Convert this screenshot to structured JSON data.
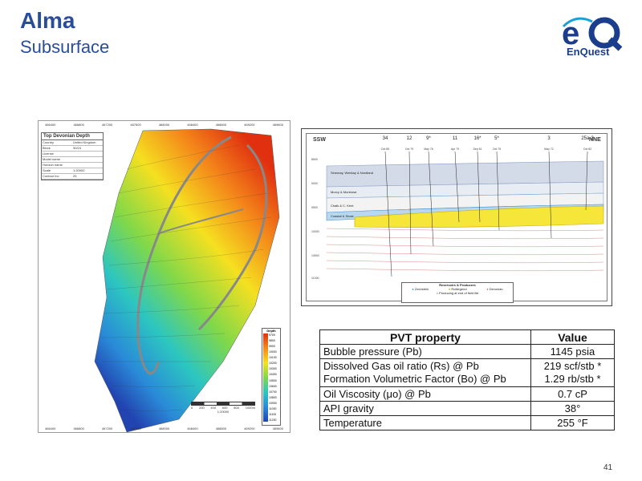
{
  "slide": {
    "title": "Alma",
    "subtitle": "Subsurface",
    "page_number": "41"
  },
  "logo": {
    "text": "EnQuest",
    "mark": "eQ",
    "colors": {
      "primary": "#1a3e8c",
      "accent": "#1aa0d8"
    }
  },
  "depth_map": {
    "title": "Top Devonian Depth",
    "legend_rows": [
      {
        "label": "Country",
        "value": "United Kingdom"
      },
      {
        "label": "Block",
        "value": "30/24"
      },
      {
        "label": "License",
        "value": ""
      },
      {
        "label": "Model name",
        "value": ""
      },
      {
        "label": "Horizon name",
        "value": ""
      },
      {
        "label": "Scale",
        "value": "1:20000"
      },
      {
        "label": "Contour inc",
        "value": "25"
      }
    ],
    "top_ticks": [
      "466400",
      "466800",
      "467200",
      "467600",
      "468000",
      "468400",
      "468800",
      "469200",
      "469600"
    ],
    "bottom_ticks": [
      "466400",
      "466800",
      "467200",
      "467600",
      "468000",
      "468400",
      "468800",
      "469200",
      "469600"
    ],
    "depth_scale_title": "Depth",
    "depth_scale_values": [
      "9700",
      "9800",
      "9900",
      "10000",
      "10100",
      "10200",
      "10300",
      "10400",
      "10500",
      "10600",
      "10700",
      "10800",
      "10900",
      "11000",
      "11100",
      "11200"
    ],
    "scale_values": [
      "0",
      "200",
      "400",
      "600",
      "800",
      "1000m"
    ],
    "scale_text": "1:20000"
  },
  "cross_section": {
    "left_label": "SSW",
    "right_label": "NNE",
    "wells": [
      {
        "name": "34",
        "date": "Oct 85"
      },
      {
        "name": "12",
        "date": "Oct 79"
      },
      {
        "name": "9*",
        "date": "May 76"
      },
      {
        "name": "11",
        "date": "Apr 79"
      },
      {
        "name": "16*",
        "date": "Sep 81"
      },
      {
        "name": "5*",
        "date": "Oct 75"
      },
      {
        "name": "3",
        "date": "May 72"
      },
      {
        "name": "25a-2",
        "date": "Oct 82"
      }
    ],
    "depths": [
      "8500",
      "9000",
      "9500",
      "10000",
      "10500",
      "11000"
    ],
    "formations": [
      "Sinemay, Weekay & Nordland",
      "Murcy & Montrose",
      "Chalk & C. Kent",
      "Coastal & Shale"
    ],
    "legend_title": "Reservoirs & Producers",
    "legend_items": [
      "Zechstein",
      "Rotliegend",
      "Devonian"
    ],
    "legend_note": "= Producing at end of field life"
  },
  "pvt_table": {
    "headers": {
      "property": "PVT property",
      "value": "Value"
    },
    "rows": [
      {
        "property": "Bubble pressure (Pb)",
        "value": "1145 psia"
      },
      {
        "property": "Dissolved Gas oil ratio (Rs) @ Pb",
        "value": "219 scf/stb *"
      },
      {
        "property": "Formation Volumetric Factor (Bo) @ Pb",
        "value": "1.29 rb/stb *"
      },
      {
        "property": "Oil Viscosity (μo) @ Pb",
        "value": "0.7 cP"
      },
      {
        "property": "API gravity",
        "value": "38°"
      },
      {
        "property": "Temperature",
        "value": "255 °F"
      }
    ]
  }
}
